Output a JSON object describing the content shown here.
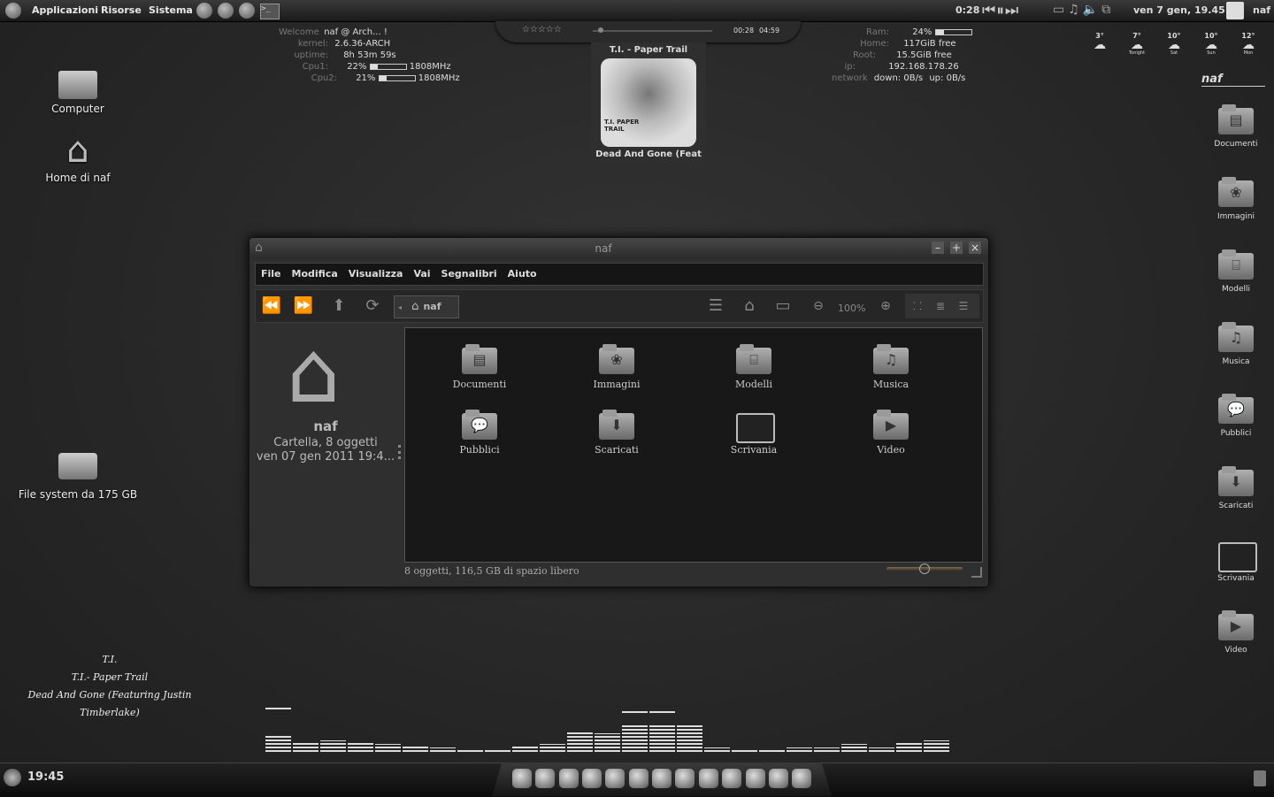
{
  "top_panel": {
    "menus": [
      "Applicazioni",
      "Risorse",
      "Sistema"
    ],
    "track_time": "0:28",
    "datetime": "ven  7 gen, 19.45",
    "user": "naf"
  },
  "conky_left": {
    "welcome_label": "Welcome",
    "welcome_value": "naf @ Arch... !",
    "kernel_label": "kernel:",
    "kernel_value": "2.6.36-ARCH",
    "uptime_label": "uptime:",
    "uptime_value": "8h 53m 59s",
    "cpu1_label": "Cpu1:",
    "cpu1_pct": "22%",
    "cpu1_level": 0.22,
    "cpu1_freq": "1808MHz",
    "cpu2_label": "Cpu2:",
    "cpu2_pct": "21%",
    "cpu2_level": 0.21,
    "cpu2_freq": "1808MHz"
  },
  "conky_right": {
    "ram_label": "Ram:",
    "ram_pct": "24%",
    "ram_level": 0.24,
    "home_label": "Home:",
    "home_value": "117GiB free",
    "root_label": "Root:",
    "root_value": "15.5GiB free",
    "ip_label": "ip:",
    "ip_value": "192.168.178.26",
    "network_label": "network",
    "down_value": "down: 0B/s",
    "up_value": "up: 0B/s"
  },
  "player": {
    "stars": "☆☆☆☆☆",
    "elapsed": "00:28",
    "total": "04:59",
    "album": "T.I. - Paper Trail",
    "cover_text": "T.I. PAPER TRAIL",
    "now_playing": "Dead And Gone (Feat"
  },
  "weather": [
    {
      "temp": "3°",
      "day": ""
    },
    {
      "temp": "7°",
      "day": "Tonight"
    },
    {
      "temp": "10°",
      "day": "Sat"
    },
    {
      "temp": "10°",
      "day": "Sun"
    },
    {
      "temp": "12°",
      "day": "Mon"
    }
  ],
  "desktop_icons": {
    "computer": "Computer",
    "home": "Home di naf",
    "filesystem": "File system da 175 GB"
  },
  "right_dock": {
    "title": "naf",
    "items": [
      "Documenti",
      "Immagini",
      "Modelli",
      "Musica",
      "Pubblici",
      "Scaricati",
      "Scrivania",
      "Video"
    ]
  },
  "lyrics": {
    "line1": "T.I.",
    "line2": "T.I.- Paper Trail",
    "line3": "Dead And Gone (Featuring Justin",
    "line4": "Timberlake)"
  },
  "window": {
    "title": "naf",
    "menus": [
      "File",
      "Modifica",
      "Visualizza",
      "Vai",
      "Segnalibri",
      "Aiuto"
    ],
    "breadcrumb": "naf",
    "zoom": "100%",
    "side_name": "naf",
    "side_info": "Cartella, 8 oggetti",
    "side_date": "ven 07 gen 2011 19:4...",
    "folders": [
      "Documenti",
      "Immagini",
      "Modelli",
      "Musica",
      "Pubblici",
      "Scaricati",
      "Scrivania",
      "Video"
    ],
    "status": "8 oggetti, 116,5 GB di spazio libero"
  },
  "bottom_panel": {
    "clock": "19:45"
  },
  "equalizer": {
    "levels": [
      0.4,
      0.2,
      0.25,
      0.2,
      0.18,
      0.15,
      0.1,
      0.05,
      0.08,
      0.12,
      0.18,
      0.48,
      0.42,
      0.6,
      0.6,
      0.62,
      0.1,
      0.08,
      0.08,
      0.1,
      0.1,
      0.18,
      0.1,
      0.2,
      0.25
    ],
    "peaks": [
      1.0,
      0.2,
      0.25,
      0.2,
      0.18,
      0.15,
      0.1,
      0.05,
      0.08,
      0.12,
      0.18,
      0.48,
      0.42,
      0.92,
      0.92,
      0.62,
      0.1,
      0.08,
      0.08,
      0.1,
      0.1,
      0.18,
      0.1,
      0.2,
      0.25
    ]
  }
}
